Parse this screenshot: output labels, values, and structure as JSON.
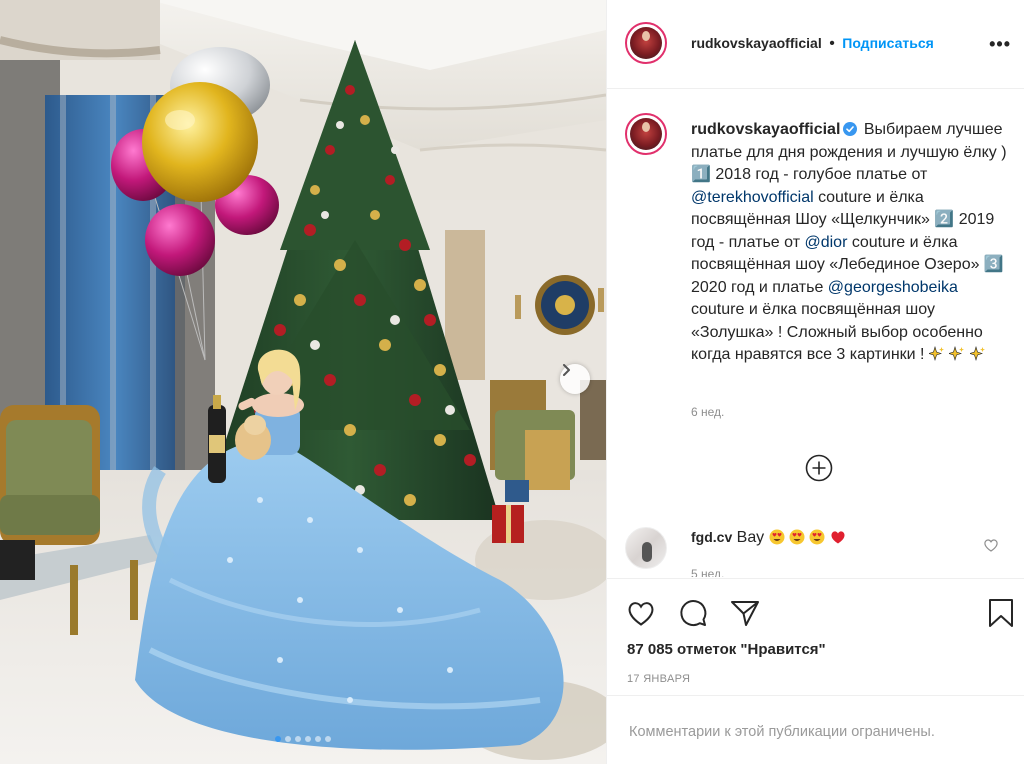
{
  "post": {
    "username": "rudkovskayaofficial",
    "separator": "•",
    "follow_label": "Подписаться",
    "more_label": "•••",
    "verified_icon": "verified-badge-icon",
    "accent_color": "#0095f6"
  },
  "caption": {
    "username": "rudkovskayaofficial",
    "part1": " Выбираем лучшее платье для дня рождения и лучшую ёлку ) 1️⃣ 2018 год - голубое платье от ",
    "mention1": "@terekhovofficial",
    "part2": " couture и ёлка посвящённая Шоу «Щелкунчик» 2️⃣ 2019 год - платье от ",
    "mention2": "@dior",
    "part3": " couture и ёлка посвящённая шоу «Лебединое Озеро» 3️⃣ 2020 год и платье ",
    "mention3": "@georgeshobeika",
    "part4": " couture и ёлка посвящённая шоу «Золушка» ! Сложный выбор особенно когда нравятся все 3 картинки ! ",
    "emojis": [
      "sparkles-icon",
      "sparkles-icon",
      "sparkles-icon"
    ],
    "time": "6 нед."
  },
  "comment": {
    "username": "fgd.cv",
    "text": " Вау ",
    "emojis": [
      "heart-eyes-icon",
      "heart-eyes-icon",
      "heart-eyes-icon",
      "red-heart-icon"
    ],
    "time": "5 нед."
  },
  "actions": {
    "likes": "87 085 отметок \"Нравится\"",
    "date": "17 ЯНВАРЯ",
    "closed_text": "Комментарии к этой публикации ограничены."
  },
  "carousel": {
    "count": 6,
    "active": 0
  }
}
